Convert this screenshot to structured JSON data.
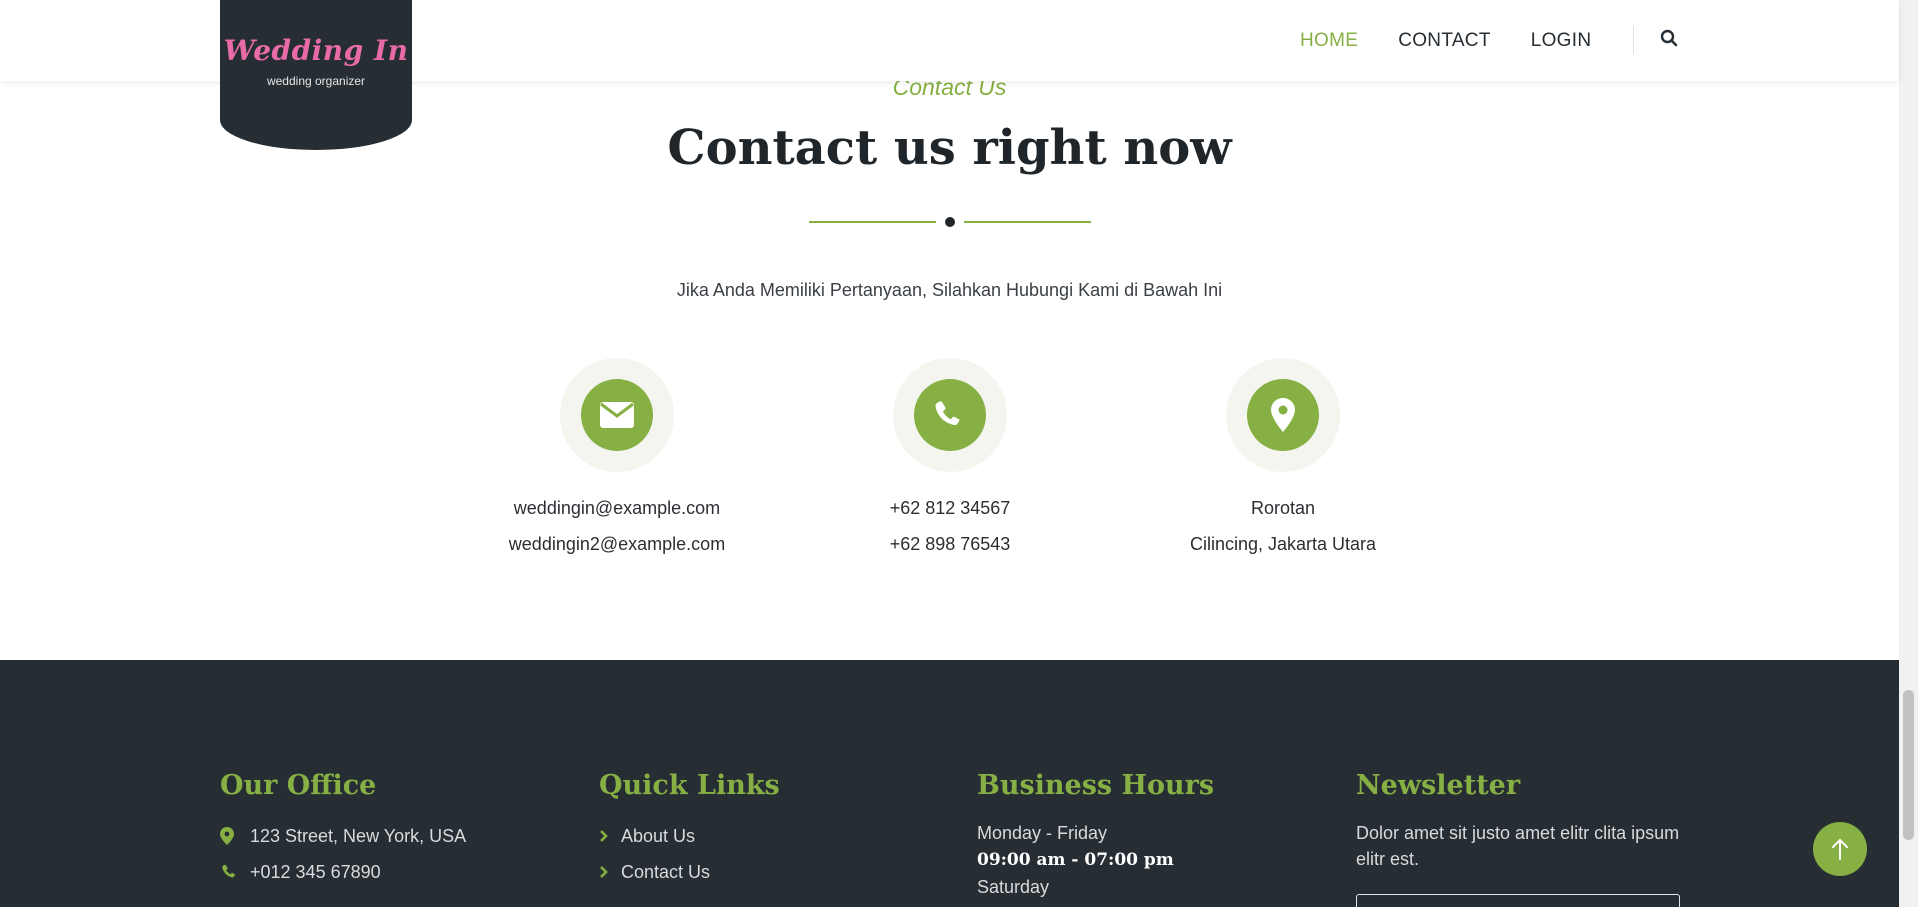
{
  "header": {
    "logo": {
      "main": "Wedding In",
      "sub": "wedding organizer"
    },
    "nav": [
      {
        "label": "HOME",
        "active": true
      },
      {
        "label": "CONTACT",
        "active": false
      },
      {
        "label": "LOGIN",
        "active": false
      }
    ],
    "search_icon": "search-icon"
  },
  "contact": {
    "subtitle": "Contact Us",
    "title": "Contact us right now",
    "description": "Jika Anda Memiliki Pertanyaan, Silahkan Hubungi Kami di Bawah Ini",
    "columns": [
      {
        "icon": "envelope-icon",
        "lines": [
          "weddingin@example.com",
          "weddingin2@example.com"
        ]
      },
      {
        "icon": "phone-icon",
        "lines": [
          "+62 812 34567",
          "+62 898 76543"
        ]
      },
      {
        "icon": "map-marker-icon",
        "lines": [
          "Rorotan",
          "Cilincing, Jakarta Utara"
        ]
      }
    ]
  },
  "footer": {
    "office": {
      "title": "Our Office",
      "items": [
        {
          "icon": "map-marker-icon",
          "text": "123 Street, New York, USA"
        },
        {
          "icon": "phone-icon",
          "text": "+012 345 67890"
        }
      ]
    },
    "quick_links": {
      "title": "Quick Links",
      "items": [
        "About Us",
        "Contact Us"
      ]
    },
    "hours": {
      "title": "Business Hours",
      "days": "Monday - Friday",
      "time": "09:00 am - 07:00 pm",
      "days2": "Saturday"
    },
    "newsletter": {
      "title": "Newsletter",
      "text": "Dolor amet sit justo amet elitr clita ipsum elitr est.",
      "input_placeholder": ""
    }
  },
  "back_to_top_icon": "arrow-up-icon",
  "colors": {
    "accent": "#86b043",
    "dark": "#262d33",
    "logo_pink": "#e86aa6"
  }
}
